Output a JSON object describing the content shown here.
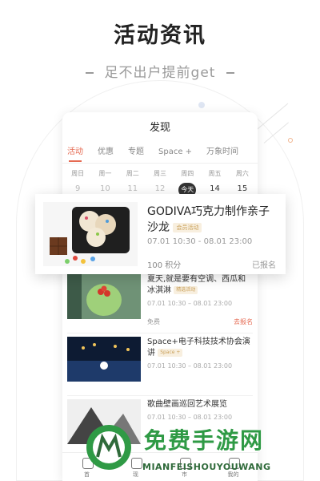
{
  "promo": {
    "title": "活动资讯",
    "subtitle": "足不出户提前get"
  },
  "phone": {
    "header_title": "发现",
    "tabs": [
      {
        "label": "活动",
        "active": true
      },
      {
        "label": "优惠"
      },
      {
        "label": "专题"
      },
      {
        "label": "Space +"
      },
      {
        "label": "万象时间"
      }
    ],
    "week": {
      "days": [
        "周日",
        "周一",
        "周二",
        "周三",
        "周四",
        "周五",
        "周六"
      ],
      "dates": [
        "9",
        "10",
        "11",
        "12",
        "今天",
        "14",
        "15"
      ]
    },
    "items": [
      {
        "title": "夏天,就是要有空调、西瓜和冰淇淋",
        "tag": "精选活动",
        "time": "07.01 10:30 – 08.01 23:00",
        "price": "免费",
        "status": "去报名"
      },
      {
        "title": "Space+电子科技技术协会演讲",
        "tag": "Space +",
        "time": "07.01 10:30 – 08.01 23:00",
        "price": "",
        "status": ""
      },
      {
        "title": "歌曲壁画巡回艺术展览",
        "tag": "",
        "time": "07.01 10:30 – 08.01 23:00",
        "price": "",
        "status": ""
      }
    ],
    "bottom_nav": [
      "首",
      "现",
      "市",
      "我的"
    ]
  },
  "featured": {
    "title": "GODIVA巧克力制作亲子沙龙",
    "tag": "会员活动",
    "time": "07.01 10:30 - 08.01 23:00",
    "price": "100 积分",
    "status": "已报名"
  },
  "watermark": {
    "text": "免费手游网",
    "sub": "MIANFEISHOUYOUWANG"
  },
  "colors": {
    "accent": "#e56a52",
    "watermark_green": "#2f9a45"
  }
}
